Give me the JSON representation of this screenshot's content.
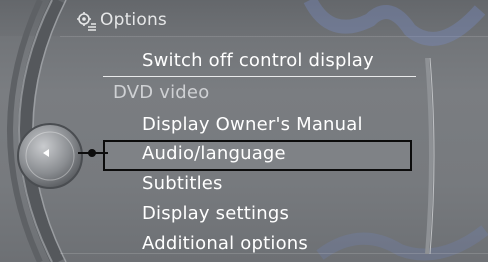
{
  "header": {
    "icon": "options-gear-icon",
    "title": "Options"
  },
  "menu": {
    "items": [
      {
        "label": "Switch off control display",
        "type": "item"
      },
      {
        "label": "DVD video",
        "type": "section"
      },
      {
        "label": "Display Owner's Manual",
        "type": "item"
      },
      {
        "label": "Audio/language",
        "type": "item",
        "selected": true
      },
      {
        "label": "Subtitles",
        "type": "item"
      },
      {
        "label": "Display settings",
        "type": "item"
      },
      {
        "label": "Additional options",
        "type": "item"
      }
    ]
  },
  "controller": {
    "icon": "controller-left-arrow-icon"
  },
  "colors": {
    "background": "#777a7e",
    "text": "#ffffff",
    "section_text": "#cfd1d4",
    "selection_border": "#0c0c0c"
  }
}
